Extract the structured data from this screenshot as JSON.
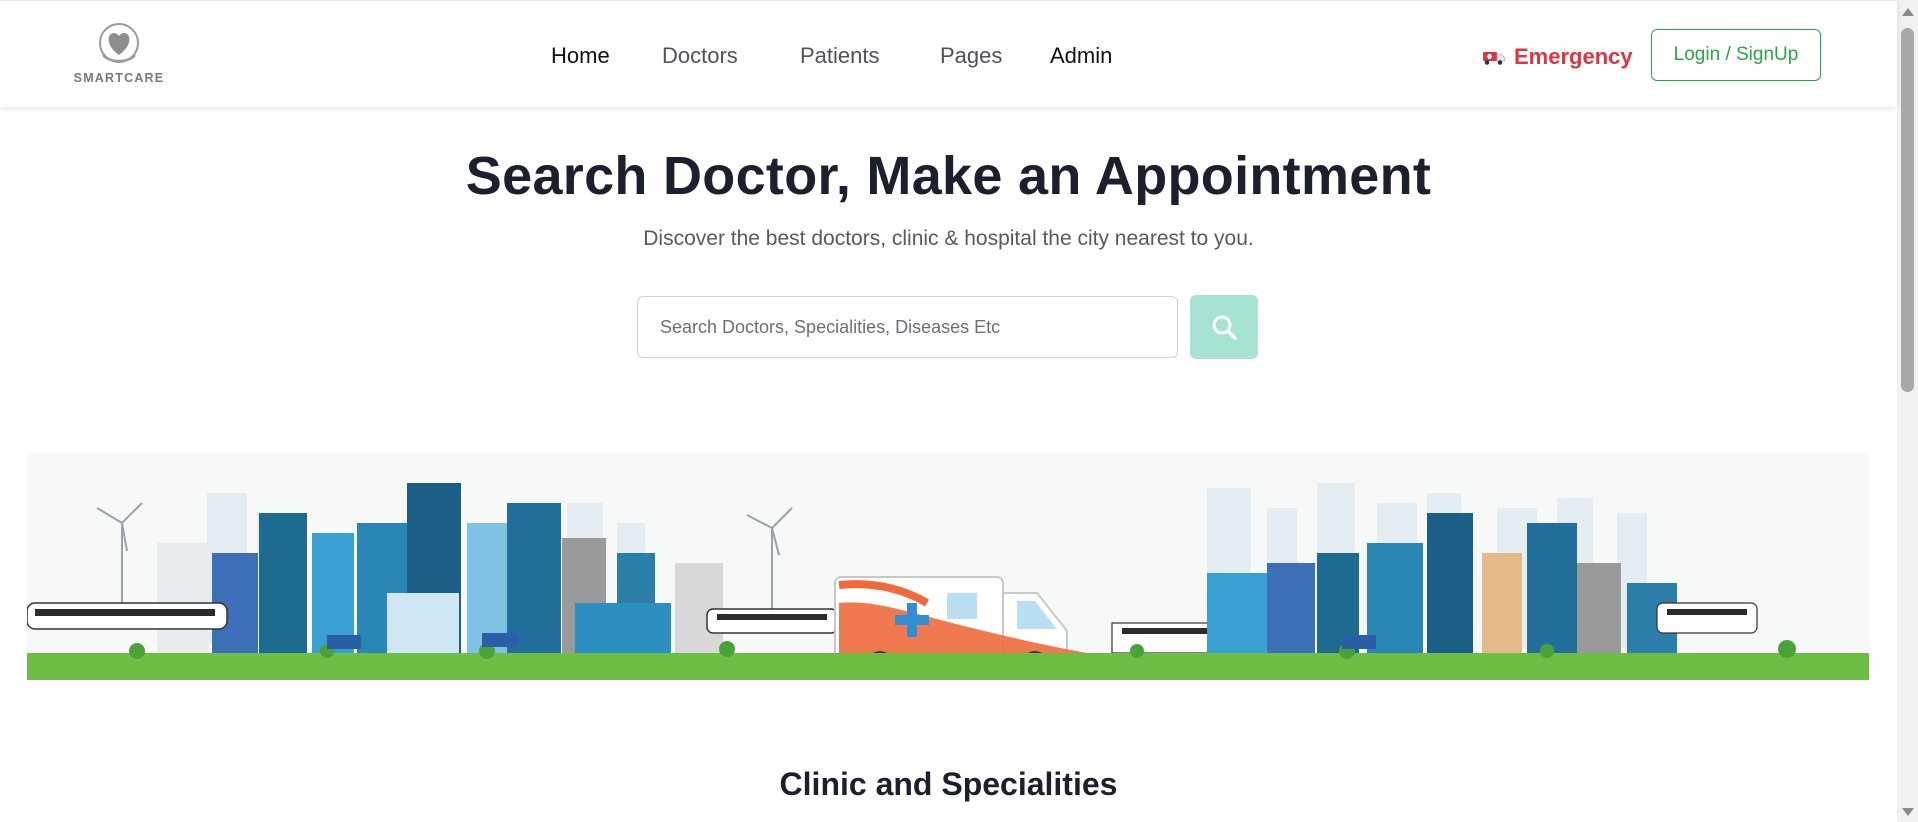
{
  "brand": {
    "name": "SMARTCARE"
  },
  "nav": {
    "items": [
      {
        "label": "Home"
      },
      {
        "label": "Doctors"
      },
      {
        "label": "Patients"
      },
      {
        "label": "Pages"
      },
      {
        "label": "Admin"
      }
    ]
  },
  "header": {
    "emergency_label": "Emergency",
    "login_label": "Login / SignUp"
  },
  "hero": {
    "title": "Search Doctor, Make an Appointment",
    "subtitle": "Discover the best doctors, clinic & hospital the city nearest to you.",
    "search_placeholder": "Search Doctors, Specialities, Diseases Etc"
  },
  "sections": {
    "clinic_title": "Clinic and Specialities"
  },
  "colors": {
    "accent_green": "#28a745",
    "emergency_red": "#dc3545",
    "search_button": "#a7e3d4"
  },
  "icons": [
    "logo-heart-icon",
    "ambulance-icon",
    "search-icon"
  ]
}
